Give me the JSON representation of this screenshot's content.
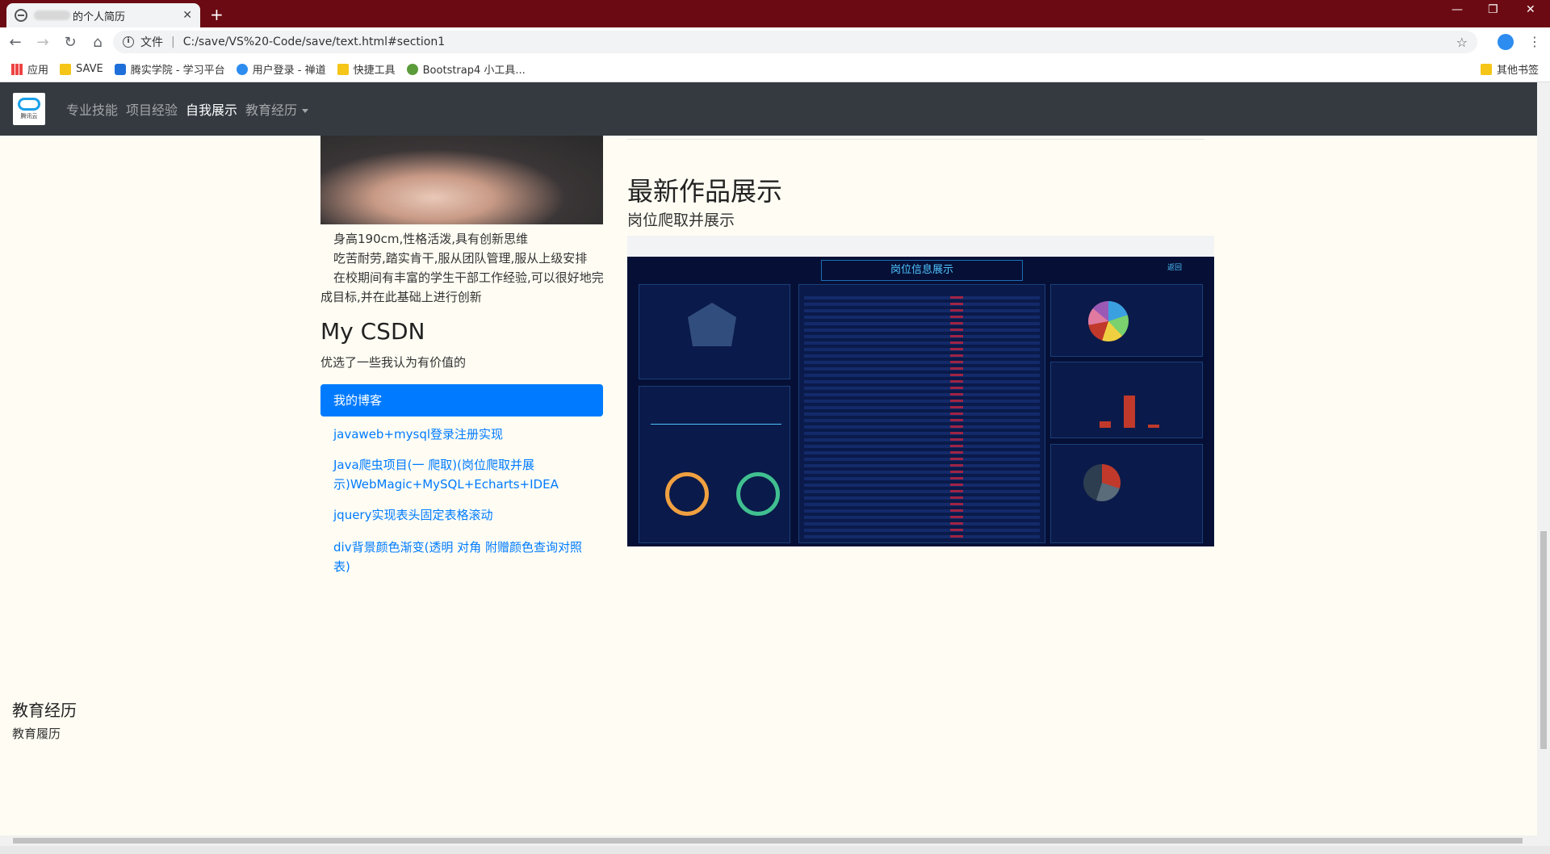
{
  "browser": {
    "tab_title": "的个人简历",
    "new_tab": "+",
    "window_controls": [
      "—",
      "❐",
      "✕"
    ],
    "address_prefix": "文件",
    "address": "C:/save/VS%20-Code/save/text.html#section1",
    "bookmarks": [
      "应用",
      "SAVE",
      "腾实学院 - 学习平台",
      "用户登录 - 禅道",
      "快捷工具",
      "Bootstrap4 小工具..."
    ],
    "bookmark_other": "其他书签"
  },
  "navbar": {
    "brand_text": "腾讯云",
    "items": [
      "专业技能",
      "项目经验",
      "自我展示",
      "教育经历"
    ],
    "active_index": 2
  },
  "profile": {
    "bio": [
      "身高190cm,性格活泼,具有创新思维",
      "吃苦耐劳,踏实肯干,服从团队管理,服从上级安排",
      "在校期间有丰富的学生干部工作经验,可以很好地完成目标,并在此基础上进行创新"
    ]
  },
  "csdn": {
    "title": "My CSDN",
    "subtitle": "优选了一些我认为有价值的",
    "active_item": "我的博客",
    "links": [
      "javaweb+mysql登录注册实现",
      "Java爬虫项目(一 爬取)(岗位爬取并展示)WebMagic+MySQL+Echarts+IDEA",
      "jquery实现表头固定表格滚动",
      "div背景颜色渐变(透明 对角 附赠颜色查询对照表)"
    ]
  },
  "works": {
    "title": "最新作品展示",
    "subtitle": "岗位爬取并展示",
    "screenshot_title": "岗位信息展示",
    "screenshot_back": "返回"
  },
  "education": {
    "title": "教育经历",
    "subtitle": "教育履历"
  }
}
